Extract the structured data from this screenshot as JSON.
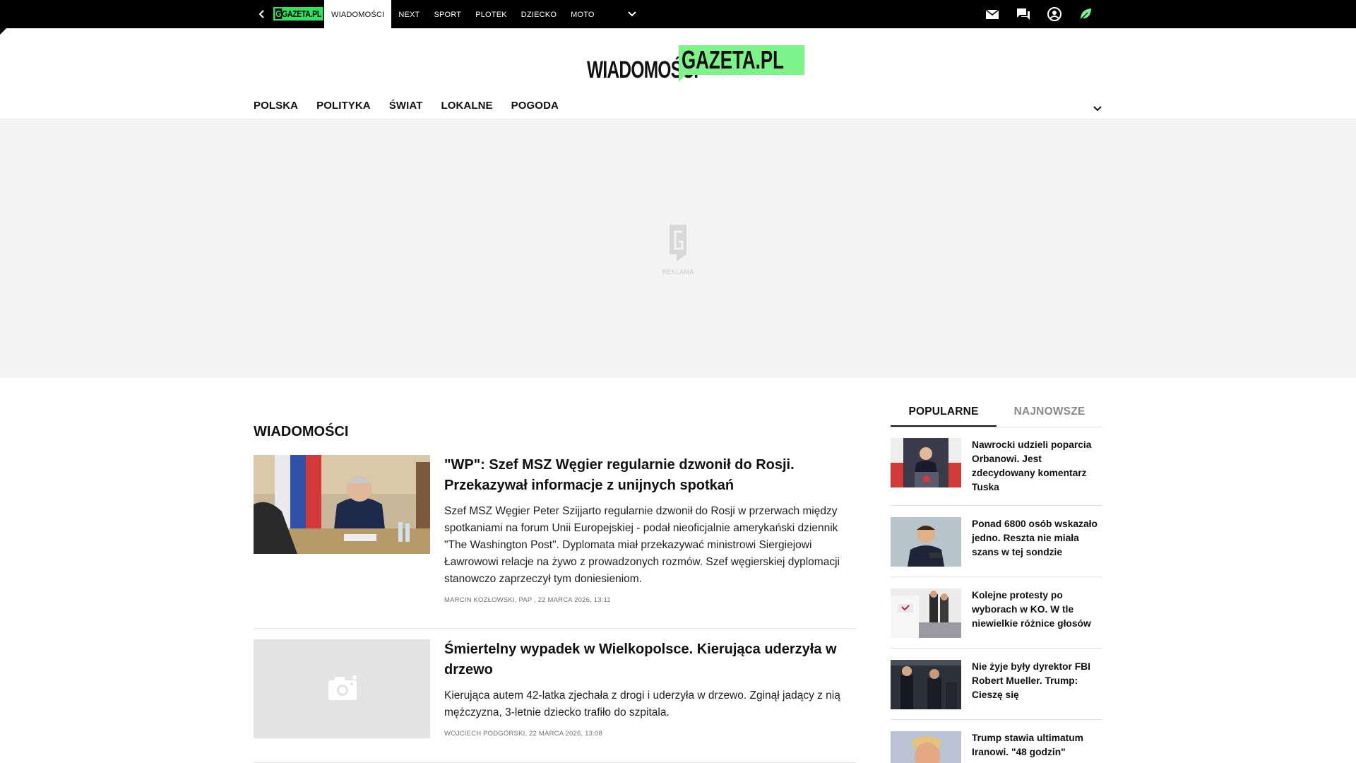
{
  "topbar": {
    "nav": [
      "WIADOMOŚCI",
      "NEXT",
      "SPORT",
      "PLOTEK",
      "DZIECKO",
      "MOTO"
    ],
    "active_index": 0,
    "accent": "#2fe25f",
    "icons": [
      "mail-icon",
      "chat-icon",
      "account-icon",
      "leaf-icon"
    ]
  },
  "logo": {
    "part1": "WIADOMOŚCI",
    "part2": "GAZETA.PL",
    "accent": "#7ef38a"
  },
  "section_nav": [
    "POLSKA",
    "POLITYKA",
    "ŚWIAT",
    "LOKALNE",
    "POGODA"
  ],
  "ad": {
    "label": "REKLAMA"
  },
  "main": {
    "section_title": "WIADOMOŚCI",
    "articles": [
      {
        "title": "\"WP\": Szef MSZ Węgier regularnie dzwonił do Rosji. Przekazywał informacje z unijnych spotkań",
        "lead": "Szef MSZ Węgier Peter Szijjarto regularnie dzwonił do Rosji w przerwach między spotkaniami na forum Unii Europejskiej - podał nieoficjalnie amerykański dziennik \"The Washington Post\". Dyplomata miał przekazywać ministrowi Siergiejowi Ławrowowi relacje na żywo z prowadzonych rozmów. Szef węgierskiej dyplomacji stanowczo zaprzeczył tym doniesieniom.",
        "meta": "MARCIN KOZŁOWSKI, PAP ,  22 MARCA 2026, 13:11"
      },
      {
        "title": "Śmiertelny wypadek w Wielkopolsce. Kierująca uderzyła w drzewo",
        "lead": "Kierująca autem 42-latka zjechała z drogi i uderzyła w drzewo. Zginął jadący z nią mężczyzna, 3-letnie dziecko trafiło do szpitala.",
        "meta": "WOJCIECH PODGÓRSKI,  22 MARCA 2026, 13:08"
      }
    ]
  },
  "sidebar": {
    "tabs": [
      "POPULARNE",
      "NAJNOWSZE"
    ],
    "active_tab": 0,
    "items": [
      {
        "title": "Nawrocki udzieli poparcia Orbanowi. Jest zdecydowany komentarz Tuska"
      },
      {
        "title": "Ponad 6800 osób wskazało jedno. Reszta nie miała szans w tej sondzie"
      },
      {
        "title": "Kolejne protesty po wyborach w KO. W tle niewielkie różnice głosów"
      },
      {
        "title": "Nie żyje były dyrektor FBI Robert Mueller. Trump: Cieszę się"
      },
      {
        "title": "Trump stawia ultimatum Iranowi. \"48 godzin\""
      }
    ]
  }
}
